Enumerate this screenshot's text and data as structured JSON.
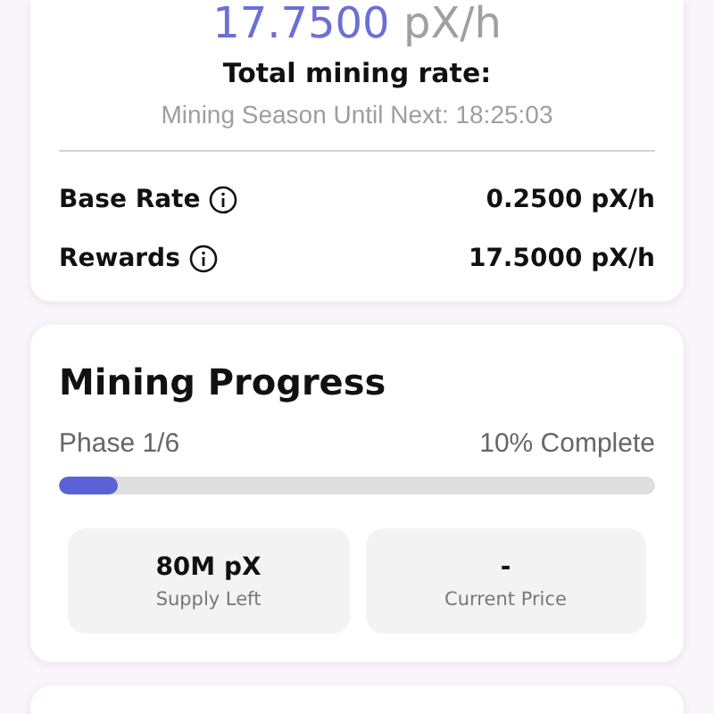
{
  "rate_card": {
    "total_rate": {
      "value": "17.7500",
      "unit": "pX/h"
    },
    "title": "Total mining rate:",
    "countdown": "Mining Season Until Next: 18:25:03",
    "rows": [
      {
        "label": "Base Rate",
        "value": "0.2500 pX/h"
      },
      {
        "label": "Rewards",
        "value": "17.5000 pX/h"
      }
    ]
  },
  "progress_card": {
    "title": "Mining Progress",
    "phase": "Phase 1/6",
    "complete": "10% Complete",
    "level": 0.1,
    "stats": [
      {
        "value": "80M pX",
        "label": "Supply Left"
      },
      {
        "value": "-",
        "label": "Current Price"
      }
    ]
  }
}
